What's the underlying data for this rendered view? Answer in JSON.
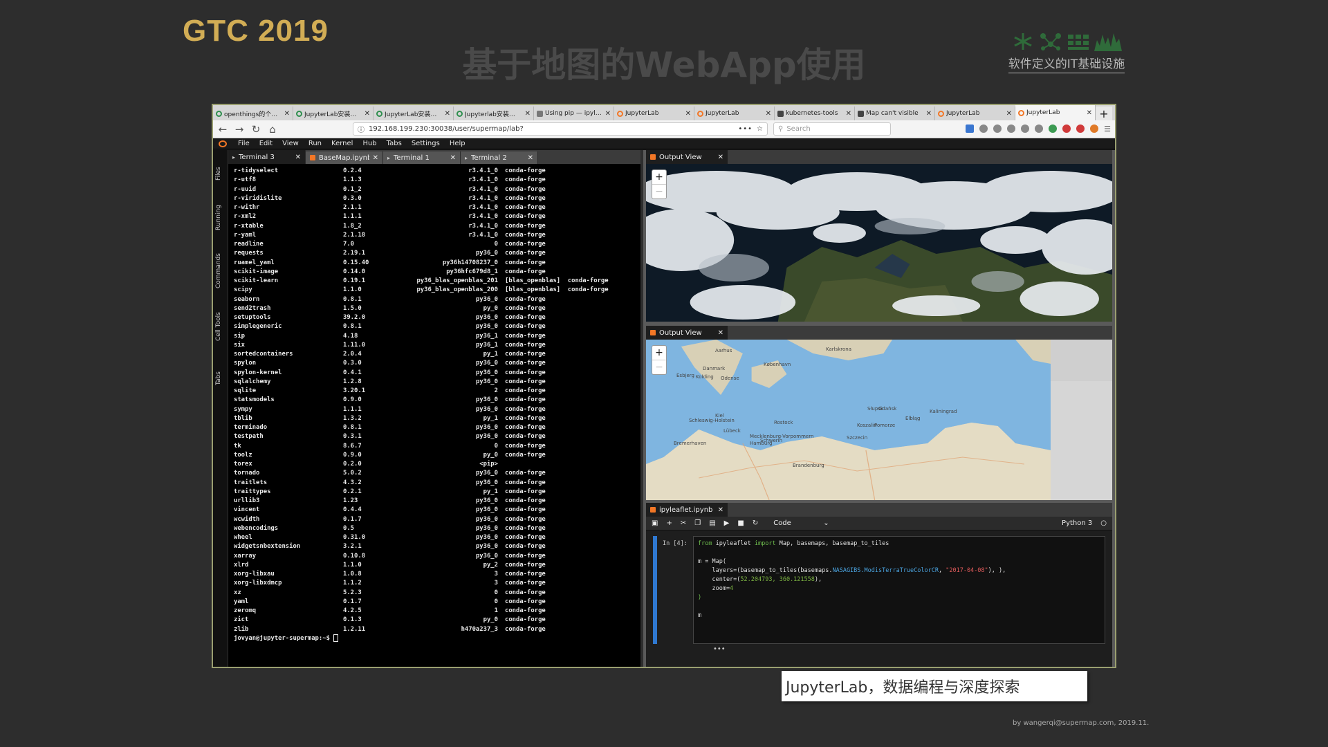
{
  "slide": {
    "logo": "GTC 2019",
    "title": "基于地图的WebApp使用",
    "brand_text": "软件定义的IT基础设施",
    "caption": "JupyterLab，数据编程与深度探索",
    "footer": "by wangerqi@supermap.com, 2019.11."
  },
  "browser": {
    "tabs": [
      {
        "label": "openthings的个…",
        "fav": "green"
      },
      {
        "label": "JupyterLab安装…",
        "fav": "green"
      },
      {
        "label": "JupyterLab安装…",
        "fav": "green"
      },
      {
        "label": "Jupyterlab安装…",
        "fav": "green"
      },
      {
        "label": "Using pip — ipyl…",
        "fav": "gray"
      },
      {
        "label": "JupyterLab",
        "fav": "orange"
      },
      {
        "label": "JupyterLab",
        "fav": "orange"
      },
      {
        "label": "kubernetes-tools",
        "fav": "dark"
      },
      {
        "label": "Map can't visible",
        "fav": "dark"
      },
      {
        "label": "JupyterLab",
        "fav": "orange"
      },
      {
        "label": "JupyterLab",
        "fav": "orange",
        "active": true
      }
    ],
    "new_tab": "+",
    "url": "192.168.199.230:30038/user/supermap/lab?",
    "url_menu": "•••",
    "search_placeholder": "Search"
  },
  "jupyter": {
    "menu": [
      "File",
      "Edit",
      "View",
      "Run",
      "Kernel",
      "Hub",
      "Tabs",
      "Settings",
      "Help"
    ],
    "sidebar": [
      "Files",
      "Running",
      "Commands",
      "Cell Tools",
      "Tabs"
    ],
    "doc_tabs": [
      {
        "label": "Terminal 3",
        "kind": "terminal",
        "active": true
      },
      {
        "label": "BaseMap.ipynb",
        "kind": "notebook"
      },
      {
        "label": "Terminal 1",
        "kind": "terminal"
      },
      {
        "label": "Terminal 2",
        "kind": "terminal"
      }
    ],
    "terminal_rows": [
      [
        "r-tidyselect",
        "0.2.4",
        "r3.4.1_0",
        "conda-forge"
      ],
      [
        "r-utf8",
        "1.1.3",
        "r3.4.1_0",
        "conda-forge"
      ],
      [
        "r-uuid",
        "0.1_2",
        "r3.4.1_0",
        "conda-forge"
      ],
      [
        "r-viridislite",
        "0.3.0",
        "r3.4.1_0",
        "conda-forge"
      ],
      [
        "r-withr",
        "2.1.1",
        "r3.4.1_0",
        "conda-forge"
      ],
      [
        "r-xml2",
        "1.1.1",
        "r3.4.1_0",
        "conda-forge"
      ],
      [
        "r-xtable",
        "1.8_2",
        "r3.4.1_0",
        "conda-forge"
      ],
      [
        "r-yaml",
        "2.1.18",
        "r3.4.1_0",
        "conda-forge"
      ],
      [
        "readline",
        "7.0",
        "0",
        "conda-forge"
      ],
      [
        "requests",
        "2.19.1",
        "py36_0",
        "conda-forge"
      ],
      [
        "ruamel_yaml",
        "0.15.40",
        "py36h14708237_0",
        "conda-forge"
      ],
      [
        "scikit-image",
        "0.14.0",
        "py36hfc679d8_1",
        "conda-forge"
      ],
      [
        "scikit-learn",
        "0.19.1",
        "py36_blas_openblas_201",
        "[blas_openblas]  conda-forge"
      ],
      [
        "scipy",
        "1.1.0",
        "py36_blas_openblas_200",
        "[blas_openblas]  conda-forge"
      ],
      [
        "seaborn",
        "0.8.1",
        "py36_0",
        "conda-forge"
      ],
      [
        "send2trash",
        "1.5.0",
        "py_0",
        "conda-forge"
      ],
      [
        "setuptools",
        "39.2.0",
        "py36_0",
        "conda-forge"
      ],
      [
        "simplegeneric",
        "0.8.1",
        "py36_0",
        "conda-forge"
      ],
      [
        "sip",
        "4.18",
        "py36_1",
        "conda-forge"
      ],
      [
        "six",
        "1.11.0",
        "py36_1",
        "conda-forge"
      ],
      [
        "sortedcontainers",
        "2.0.4",
        "py_1",
        "conda-forge"
      ],
      [
        "spylon",
        "0.3.0",
        "py36_0",
        "conda-forge"
      ],
      [
        "spylon-kernel",
        "0.4.1",
        "py36_0",
        "conda-forge"
      ],
      [
        "sqlalchemy",
        "1.2.8",
        "py36_0",
        "conda-forge"
      ],
      [
        "sqlite",
        "3.20.1",
        "2",
        "conda-forge"
      ],
      [
        "statsmodels",
        "0.9.0",
        "py36_0",
        "conda-forge"
      ],
      [
        "sympy",
        "1.1.1",
        "py36_0",
        "conda-forge"
      ],
      [
        "tblib",
        "1.3.2",
        "py_1",
        "conda-forge"
      ],
      [
        "terminado",
        "0.8.1",
        "py36_0",
        "conda-forge"
      ],
      [
        "testpath",
        "0.3.1",
        "py36_0",
        "conda-forge"
      ],
      [
        "tk",
        "8.6.7",
        "0",
        "conda-forge"
      ],
      [
        "toolz",
        "0.9.0",
        "py_0",
        "conda-forge"
      ],
      [
        "torex",
        "0.2.0",
        "<pip>",
        ""
      ],
      [
        "tornado",
        "5.0.2",
        "py36_0",
        "conda-forge"
      ],
      [
        "traitlets",
        "4.3.2",
        "py36_0",
        "conda-forge"
      ],
      [
        "traittypes",
        "0.2.1",
        "py_1",
        "conda-forge"
      ],
      [
        "urllib3",
        "1.23",
        "py36_0",
        "conda-forge"
      ],
      [
        "vincent",
        "0.4.4",
        "py36_0",
        "conda-forge"
      ],
      [
        "wcwidth",
        "0.1.7",
        "py36_0",
        "conda-forge"
      ],
      [
        "webencodings",
        "0.5",
        "py36_0",
        "conda-forge"
      ],
      [
        "wheel",
        "0.31.0",
        "py36_0",
        "conda-forge"
      ],
      [
        "widgetsnbextension",
        "3.2.1",
        "py36_0",
        "conda-forge"
      ],
      [
        "xarray",
        "0.10.8",
        "py36_0",
        "conda-forge"
      ],
      [
        "xlrd",
        "1.1.0",
        "py_2",
        "conda-forge"
      ],
      [
        "xorg-libxau",
        "1.0.8",
        "3",
        "conda-forge"
      ],
      [
        "xorg-libxdmcp",
        "1.1.2",
        "3",
        "conda-forge"
      ],
      [
        "xz",
        "5.2.3",
        "0",
        "conda-forge"
      ],
      [
        "yaml",
        "0.1.7",
        "0",
        "conda-forge"
      ],
      [
        "zeromq",
        "4.2.5",
        "1",
        "conda-forge"
      ],
      [
        "zict",
        "0.1.3",
        "py_0",
        "conda-forge"
      ],
      [
        "zlib",
        "1.2.11",
        "h470a237_3",
        "conda-forge"
      ]
    ],
    "prompt": "jovyan@jupyter-supermap:~$ ",
    "output_view_1": "Output View",
    "output_view_2": "Output View",
    "notebook_tab": "ipyleaflet.ipynb",
    "cell_type": "Code",
    "kernel": "Python 3",
    "cell_prompt": "In [4]:",
    "code_lines": {
      "l1_kw1": "from",
      "l1_mod": " ipyleaflet ",
      "l1_kw2": "import",
      "l1_rest": " Map, basemaps, basemap_to_tiles",
      "l2": "m = Map(",
      "l3a": "    layers=(basemap_to_tiles(basemaps.",
      "l3b": "NASAGIBS.ModisTerraTrueColorCR",
      "l3c": ", ",
      "l3d": "\"2017-04-08\"",
      "l3e": "), ),",
      "l4a": "    center=(",
      "l4b": "52.204793, 360.121558",
      "l4c": "),",
      "l5a": "    zoom=",
      "l5b": "4",
      "l6": ")",
      "l7": "m"
    },
    "cell_ellipsis": "•••",
    "map_labels": [
      "Aarhus",
      "Danmark",
      "København",
      "Odense",
      "Kolding",
      "Esbjerg",
      "Kiel",
      "Lübeck",
      "Hamburg",
      "Bremerhaven",
      "Rostock",
      "Szczecin",
      "Gdańsk",
      "Koszalin",
      "Słupsk",
      "Elbląg",
      "Kaliningrad",
      "Mecklenburg-Vorpommern",
      "Schleswig-Holstein",
      "Brandenburg",
      "Pomorze",
      "Schwerin",
      "Karlskrona"
    ]
  }
}
